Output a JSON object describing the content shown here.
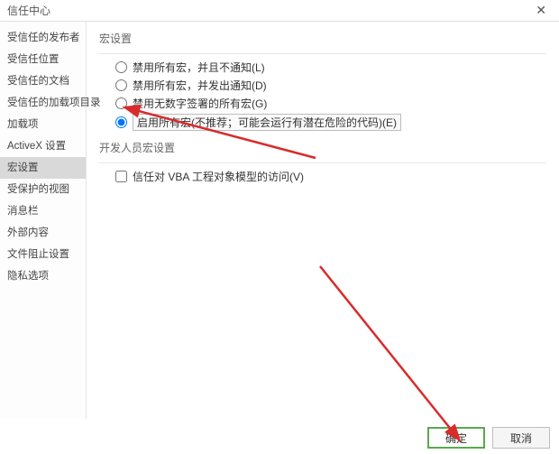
{
  "window": {
    "title": "信任中心"
  },
  "sidebar": {
    "items": [
      {
        "label": "受信任的发布者"
      },
      {
        "label": "受信任位置"
      },
      {
        "label": "受信任的文档"
      },
      {
        "label": "受信任的加载项目录"
      },
      {
        "label": "加载项"
      },
      {
        "label": "ActiveX 设置"
      },
      {
        "label": "宏设置"
      },
      {
        "label": "受保护的视图"
      },
      {
        "label": "消息栏"
      },
      {
        "label": "外部内容"
      },
      {
        "label": "文件阻止设置"
      },
      {
        "label": "隐私选项"
      }
    ],
    "selectedIndex": 6
  },
  "content": {
    "section1": {
      "title": "宏设置",
      "options": [
        {
          "label": "禁用所有宏，并且不通知(L)"
        },
        {
          "label": "禁用所有宏，并发出通知(D)"
        },
        {
          "label": "禁用无数字签署的所有宏(G)"
        },
        {
          "label": "启用所有宏(不推荐；可能会运行有潜在危险的代码)(E)"
        }
      ],
      "selectedIndex": 3
    },
    "section2": {
      "title": "开发人员宏设置",
      "checkbox": {
        "label": "信任对 VBA 工程对象模型的访问(V)",
        "checked": false
      }
    }
  },
  "footer": {
    "ok": "确定",
    "cancel": "取消"
  }
}
